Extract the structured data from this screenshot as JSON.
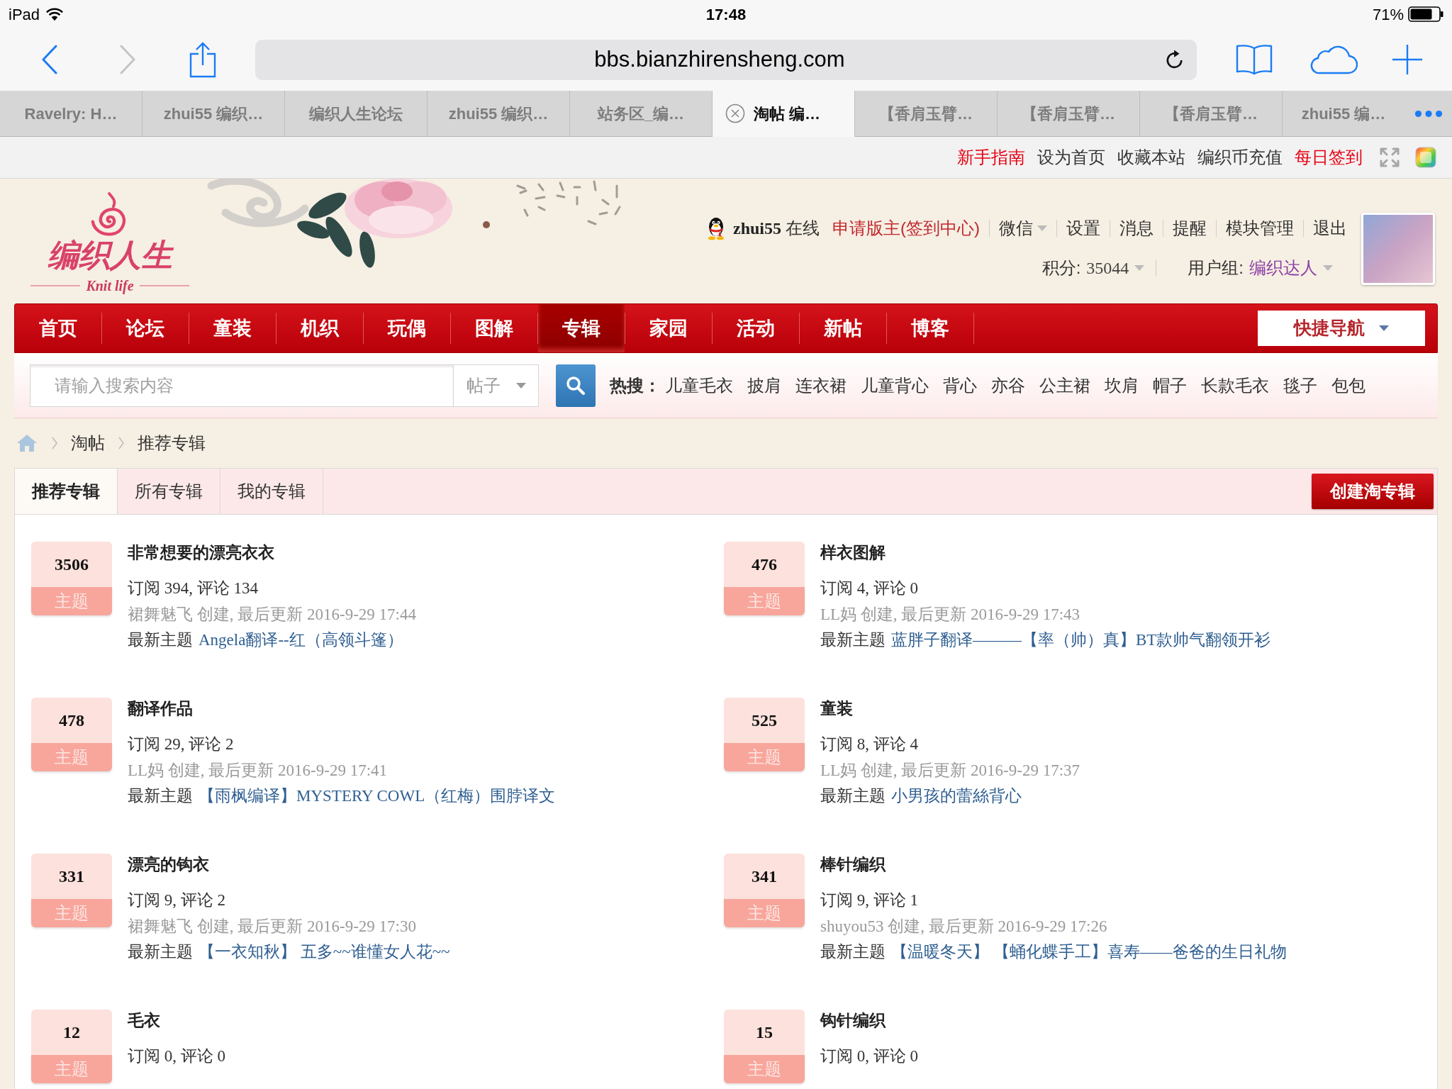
{
  "status_bar": {
    "device": "iPad",
    "time": "17:48",
    "battery": "71%"
  },
  "browser": {
    "url": "bbs.bianzhirensheng.com",
    "tabs": [
      {
        "title": "Ravelry: H…",
        "selected": false
      },
      {
        "title": "zhui55 编织…",
        "selected": false
      },
      {
        "title": "编织人生论坛",
        "selected": false
      },
      {
        "title": "zhui55 编织…",
        "selected": false
      },
      {
        "title": "站务区_编…",
        "selected": false
      },
      {
        "title": "淘帖 编…",
        "selected": true
      },
      {
        "title": "【香肩玉臂…",
        "selected": false
      },
      {
        "title": "【香肩玉臂…",
        "selected": false
      },
      {
        "title": "【香肩玉臂…",
        "selected": false
      },
      {
        "title": "zhui55 编…",
        "selected": false
      }
    ]
  },
  "top_links": [
    {
      "label": "新手指南",
      "color": "#e60012"
    },
    {
      "label": "设为首页",
      "color": "#333333"
    },
    {
      "label": "收藏本站",
      "color": "#333333"
    },
    {
      "label": "编织币充值",
      "color": "#333333"
    },
    {
      "label": "每日签到",
      "color": "#e60012"
    }
  ],
  "header": {
    "logo": {
      "name": "编织人生",
      "tagline": "Knit life"
    },
    "user": {
      "username": "zhui55",
      "status": "在线",
      "apply_link": "申请版主(签到中心)",
      "links": [
        {
          "label": "微信",
          "dropdown": true
        },
        {
          "label": "设置",
          "dropdown": false
        },
        {
          "label": "消息",
          "dropdown": false
        },
        {
          "label": "提醒",
          "dropdown": false
        },
        {
          "label": "模块管理",
          "dropdown": false
        },
        {
          "label": "退出",
          "dropdown": false
        }
      ],
      "stats": [
        {
          "label": "积分:",
          "value": "35044",
          "color": "#444444",
          "dropdown": true
        },
        {
          "label": "用户组:",
          "value": "编织达人",
          "color": "#8b3fa3",
          "dropdown": true
        }
      ]
    }
  },
  "nav": {
    "items": [
      {
        "label": "首页",
        "selected": false
      },
      {
        "label": "论坛",
        "selected": false
      },
      {
        "label": "童装",
        "selected": false
      },
      {
        "label": "机织",
        "selected": false
      },
      {
        "label": "玩偶",
        "selected": false
      },
      {
        "label": "图解",
        "selected": false
      },
      {
        "label": "专辑",
        "selected": true
      },
      {
        "label": "家园",
        "selected": false
      },
      {
        "label": "活动",
        "selected": false
      },
      {
        "label": "新帖",
        "selected": false
      },
      {
        "label": "博客",
        "selected": false
      }
    ],
    "quick_nav": "快捷导航"
  },
  "search": {
    "placeholder": "请输入搜索内容",
    "scope": "帖子",
    "hot_label": "热搜：",
    "hot_words": [
      "儿童毛衣",
      "披肩",
      "连衣裙",
      "儿童背心",
      "背心",
      "亦谷",
      "公主裙",
      "坎肩",
      "帽子",
      "长款毛衣",
      "毯子",
      "包包"
    ]
  },
  "breadcrumb": [
    "淘帖",
    "推荐专辑"
  ],
  "album_tabs": [
    {
      "label": "推荐专辑",
      "selected": true
    },
    {
      "label": "所有专辑",
      "selected": false
    },
    {
      "label": "我的专辑",
      "selected": false
    }
  ],
  "create_button": "创建淘专辑",
  "albums": [
    {
      "count": "3506",
      "badge": "主题",
      "title": "非常想要的漂亮衣衣",
      "stats": "订阅 394, 评论 134",
      "meta": "裙舞魅飞 创建, 最后更新 2016-9-29 17:44",
      "latest_label": "最新主题",
      "latest": "Angela翻译--红（高领斗篷）"
    },
    {
      "count": "476",
      "badge": "主题",
      "title": "样衣图解",
      "stats": "订阅 4, 评论 0",
      "meta": "LL妈 创建, 最后更新 2016-9-29 17:43",
      "latest_label": "最新主题",
      "latest": "蓝胖子翻译———【率（帅）真】BT款帅气翻领开衫"
    },
    {
      "count": "478",
      "badge": "主题",
      "title": "翻译作品",
      "stats": "订阅 29, 评论 2",
      "meta": "LL妈 创建, 最后更新 2016-9-29 17:41",
      "latest_label": "最新主题",
      "latest": "【雨枫编译】MYSTERY COWL（红梅）围脖译文"
    },
    {
      "count": "525",
      "badge": "主题",
      "title": "童装",
      "stats": "订阅 8, 评论 4",
      "meta": "LL妈 创建, 最后更新 2016-9-29 17:37",
      "latest_label": "最新主题",
      "latest": "小男孩的蕾絲背心"
    },
    {
      "count": "331",
      "badge": "主题",
      "title": "漂亮的钩衣",
      "stats": "订阅 9, 评论 2",
      "meta": "裙舞魅飞 创建, 最后更新 2016-9-29 17:30",
      "latest_label": "最新主题",
      "latest": "【一衣知秋】 五多~~谁懂女人花~~"
    },
    {
      "count": "341",
      "badge": "主题",
      "title": "棒针编织",
      "stats": "订阅 9, 评论 1",
      "meta": "shuyou53 创建, 最后更新 2016-9-29 17:26",
      "latest_label": "最新主题",
      "latest": "【温暖冬天】 【蛹化蝶手工】喜寿——爸爸的生日礼物"
    },
    {
      "count": "12",
      "badge": "主题",
      "title": "毛衣",
      "stats": "订阅 0, 评论 0"
    },
    {
      "count": "15",
      "badge": "主题",
      "title": "钩针编织",
      "stats": "订阅 0, 评论 0"
    }
  ]
}
